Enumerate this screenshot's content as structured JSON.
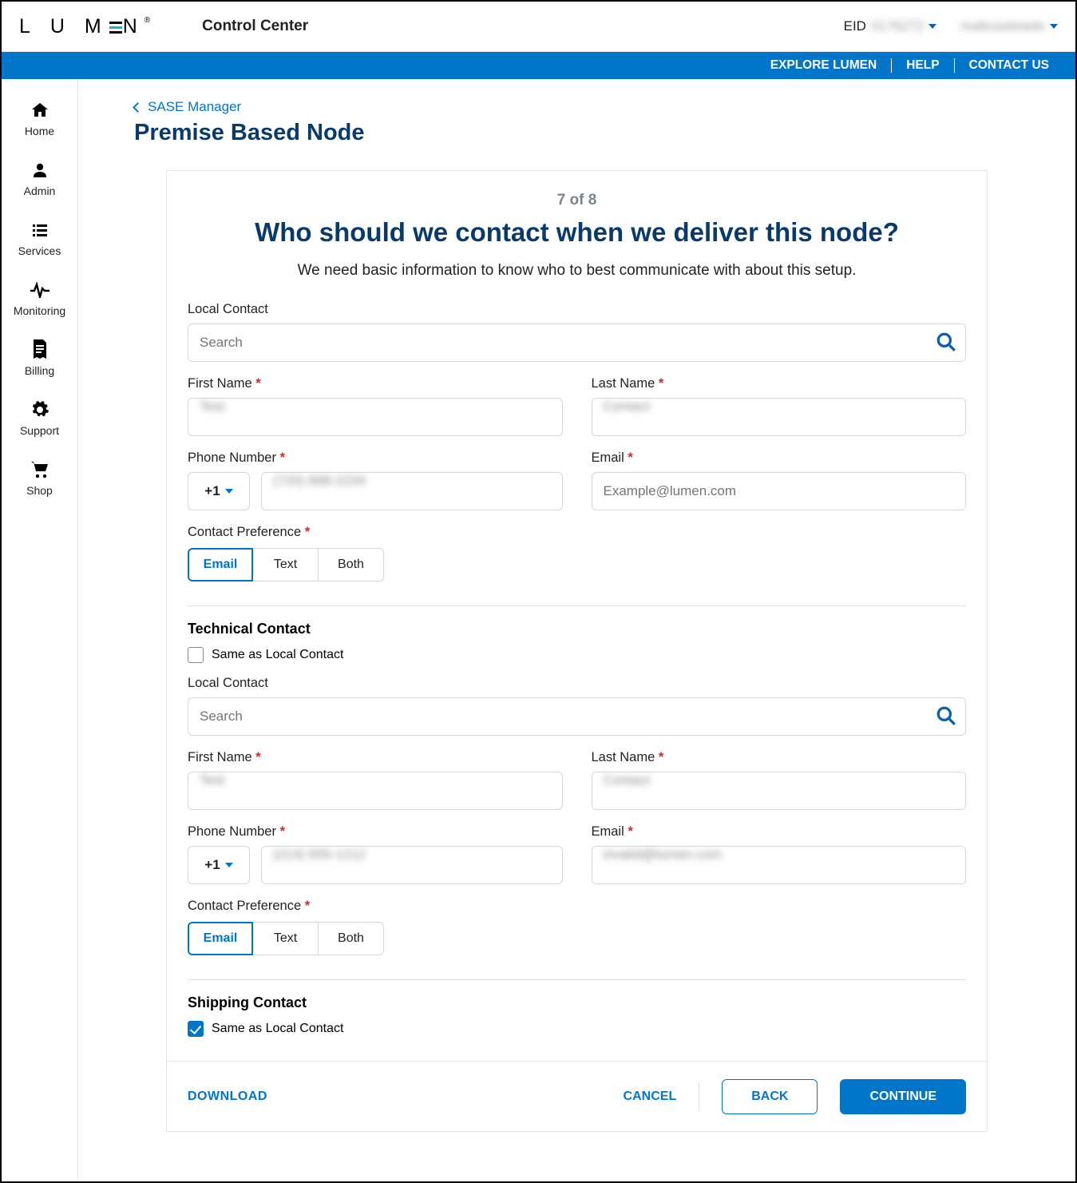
{
  "header": {
    "app": "Control Center",
    "eid_label": "EID",
    "eid_value": "0176272",
    "username": "mattcastelado"
  },
  "utilbar": {
    "explore": "EXPLORE LUMEN",
    "help": "HELP",
    "contact": "CONTACT US"
  },
  "sidebar": {
    "items": [
      {
        "label": "Home",
        "icon": "home-icon"
      },
      {
        "label": "Admin",
        "icon": "user-icon"
      },
      {
        "label": "Services",
        "icon": "list-icon"
      },
      {
        "label": "Monitoring",
        "icon": "pulse-icon"
      },
      {
        "label": "Billing",
        "icon": "invoice-icon"
      },
      {
        "label": "Support",
        "icon": "gear-icon"
      },
      {
        "label": "Shop",
        "icon": "cart-icon"
      }
    ]
  },
  "breadcrumb": "SASE Manager",
  "page_title": "Premise Based Node",
  "wizard": {
    "step": "7 of 8",
    "heading": "Who should we contact when we deliver this node?",
    "intro": "We need basic information to know who to best communicate with about this setup."
  },
  "local": {
    "search_label": "Local Contact",
    "search_placeholder": "Search",
    "first_label": "First Name",
    "first_value": "Test",
    "last_label": "Last Name",
    "last_value": "Contact",
    "phone_label": "Phone Number",
    "cc": "+1",
    "phone_value": "(720) 888-2234",
    "email_label": "Email",
    "email_placeholder": "Example@lumen.com",
    "pref_label": "Contact Preference",
    "options": {
      "email": "Email",
      "text": "Text",
      "both": "Both"
    }
  },
  "technical": {
    "title": "Technical Contact",
    "same": "Same as Local Contact",
    "same_checked": false,
    "search_label": "Local Contact",
    "search_placeholder": "Search",
    "first_label": "First Name",
    "first_value": "Test",
    "last_label": "Last Name",
    "last_value": "Contact",
    "phone_label": "Phone Number",
    "cc": "+1",
    "phone_value": "(214) 555-1212",
    "email_label": "Email",
    "email_value": "invalid@lumen.com",
    "pref_label": "Contact Preference",
    "options": {
      "email": "Email",
      "text": "Text",
      "both": "Both"
    }
  },
  "shipping": {
    "title": "Shipping Contact",
    "same": "Same as Local Contact",
    "same_checked": true
  },
  "footer": {
    "download": "DOWNLOAD",
    "cancel": "CANCEL",
    "back": "BACK",
    "continue": "CONTINUE"
  }
}
